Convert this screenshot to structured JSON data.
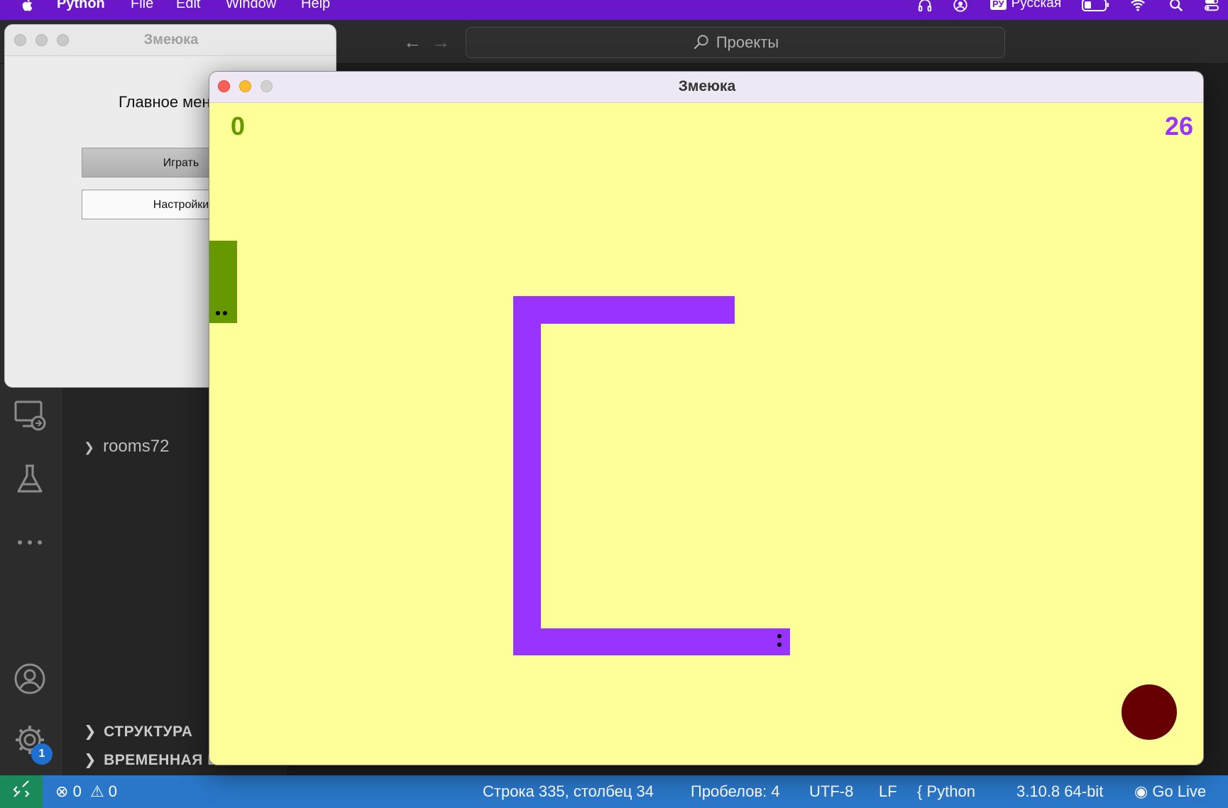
{
  "menubar": {
    "app_name": "Python",
    "menus": [
      "File",
      "Edit",
      "Window",
      "Help"
    ],
    "input_source_badge": "РУ",
    "input_source": "Русская"
  },
  "vscode": {
    "search_placeholder": "Проекты",
    "tree_item": "rooms72",
    "sections": [
      "СТРУКТУРА",
      "ВРЕМЕННАЯ ШКАЛА"
    ],
    "settings_badge": "1",
    "status": {
      "errors": "0",
      "warnings": "0",
      "position": "Строка 335, столбец 34",
      "spaces": "Пробелов: 4",
      "encoding": "UTF-8",
      "eol": "LF",
      "language": "Python",
      "interpreter": "3.10.8 64-bit",
      "golive": "Go Live"
    }
  },
  "menu_window": {
    "title": "Змеюка",
    "heading": "Главное меню",
    "play_button": "Играть",
    "settings_button": "Настройки"
  },
  "game_window": {
    "title": "Змеюка",
    "score_green": "0",
    "score_purple": "26",
    "colors": {
      "background": "#ffff99",
      "green_snake": "#669900",
      "purple_snake": "#9933ff",
      "food": "#660000"
    }
  }
}
